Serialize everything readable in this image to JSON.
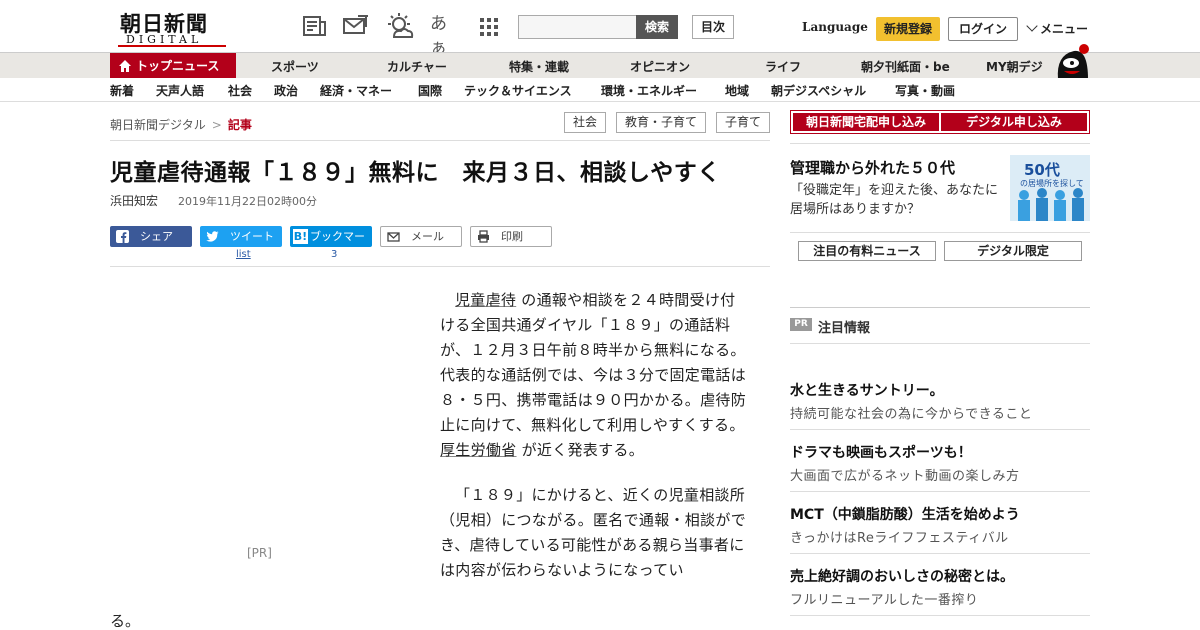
{
  "header": {
    "logo_kanji": "朝日新聞",
    "logo_sub": "DIGITAL",
    "search_button": "検索",
    "toc_button": "目次",
    "language": "Language",
    "register": "新規登録",
    "login": "ログイン",
    "menu": "メニュー",
    "icons": [
      "newspaper-icon",
      "mail-icon",
      "weather-icon",
      "font-size-icon",
      "apps-grid-icon"
    ],
    "font_size_glyph": "あぁ",
    "brand_red": "#b3001a",
    "accent_yellow": "#f2c02f"
  },
  "nav_primary": [
    "トップニュース",
    "スポーツ",
    "カルチャー",
    "特集・連載",
    "オピニオン",
    "ライフ",
    "朝夕刊紙面・be",
    "MY朝デジ"
  ],
  "nav_secondary": [
    "新着",
    "天声人語",
    "社会",
    "政治",
    "経済・マネー",
    "国際",
    "テック＆サイエンス",
    "環境・エネルギー",
    "地域",
    "朝デジスペシャル",
    "写真・動画"
  ],
  "breadcrumb": {
    "home": "朝日新聞デジタル",
    "sep": ">",
    "current": "記事"
  },
  "tags": [
    "社会",
    "教育・子育て",
    "子育て"
  ],
  "article": {
    "headline": "児童虐待通報「１８９」無料に　来月３日、相談しやすく",
    "author": "浜田知宏",
    "date": "2019年11月22日02時00分",
    "pr_label": "[PR]",
    "p1_link1": "児童虐待",
    "p1_text1": "の通報や相談を２４時間受け付ける全国共通ダイヤル「１８９」の通話料が、１２月３日午前８時半から無料になる。代表的な通話例では、今は３分で固定電話は８・５円、携帯電話は９０円かかる。虐待防止に向けて、無料化して利用しやすくする。",
    "p1_link2": "厚生労働省",
    "p1_text2": "が近く発表する。",
    "p2_text": "「１８９」にかけると、近くの児童相談所（児相）につながる。匿名で通報・相談ができ、虐待している可能性がある親ら当事者には内容が伝わらないようになってい",
    "p2_tail": "る。"
  },
  "share": {
    "facebook": "シェア",
    "twitter": "ツイート",
    "twitter_count": "list",
    "hatena": "ブックマーク",
    "hatena_count": "3",
    "mail": "メール",
    "print": "印刷",
    "facebook_color": "#3b5998",
    "twitter_color": "#1da1f2",
    "hatena_color": "#008fde"
  },
  "sidebar": {
    "subscribe_paper": "朝日新聞宅配申し込み",
    "subscribe_digital": "デジタル申し込み",
    "promo_title": "管理職から外れた５０代",
    "promo_text": "「役職定年」を迎えた後、あなたに居場所はありますか？",
    "promo_image_caption": "50代",
    "promo_image_sub": "の居場所を探して",
    "tab_paid": "注目の有料ニュース",
    "tab_digital": "デジタル限定",
    "pr_badge": "PR",
    "pr_heading": "注目情報",
    "ads": [
      {
        "title": "水と生きるサントリー。",
        "sub": "持続可能な社会の為に今からできること"
      },
      {
        "title": "ドラマも映画もスポーツも！",
        "sub": "大画面で広がるネット動画の楽しみ方"
      },
      {
        "title": "MCT（中鎖脂肪酸）生活を始めよう",
        "sub": "きっかけはReライフフェスティバル"
      },
      {
        "title": "売上絶好調のおいしさの秘密とは。",
        "sub": "フルリニューアルした一番搾り"
      }
    ]
  }
}
